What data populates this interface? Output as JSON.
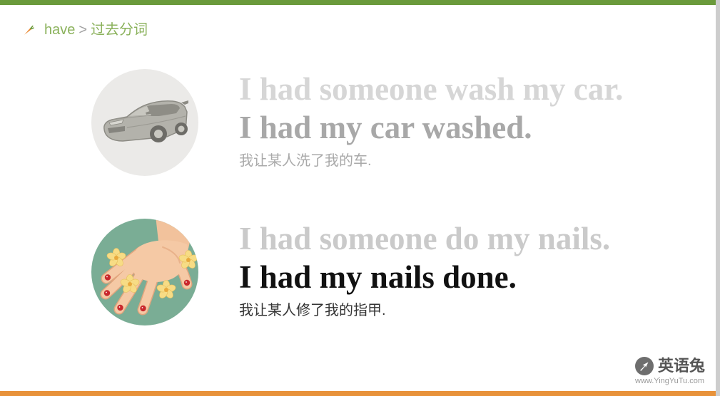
{
  "theme": {
    "top_bar_color": "#6a9a3b",
    "bottom_bar_color": "#e8923a",
    "accent_text_color": "#8bb25c",
    "separator_color": "#a0a0a0"
  },
  "breadcrumb": {
    "icon": "carrot-icon",
    "topic": "have",
    "separator": ">",
    "subtopic": "过去分词"
  },
  "examples": [
    {
      "illustration": "car-illustration",
      "active_sentence": "I had someone wash my car.",
      "passive_sentence": "I had my car washed.",
      "translation": "我让某人洗了我的车.",
      "colors": {
        "active": "#d6d6d6",
        "passive": "#a8a8a8",
        "translation": "#a9a9a9"
      }
    },
    {
      "illustration": "hand-nails-illustration",
      "active_sentence": "I had someone do my nails.",
      "passive_sentence": "I had my nails done.",
      "translation": "我让某人修了我的指甲.",
      "colors": {
        "active": "#cacaca",
        "passive": "#111111",
        "translation": "#333333"
      }
    }
  ],
  "logo": {
    "icon": "yingyutu-logo-icon",
    "name": "英语兔",
    "website_text": "www.YingYuTu.com"
  }
}
